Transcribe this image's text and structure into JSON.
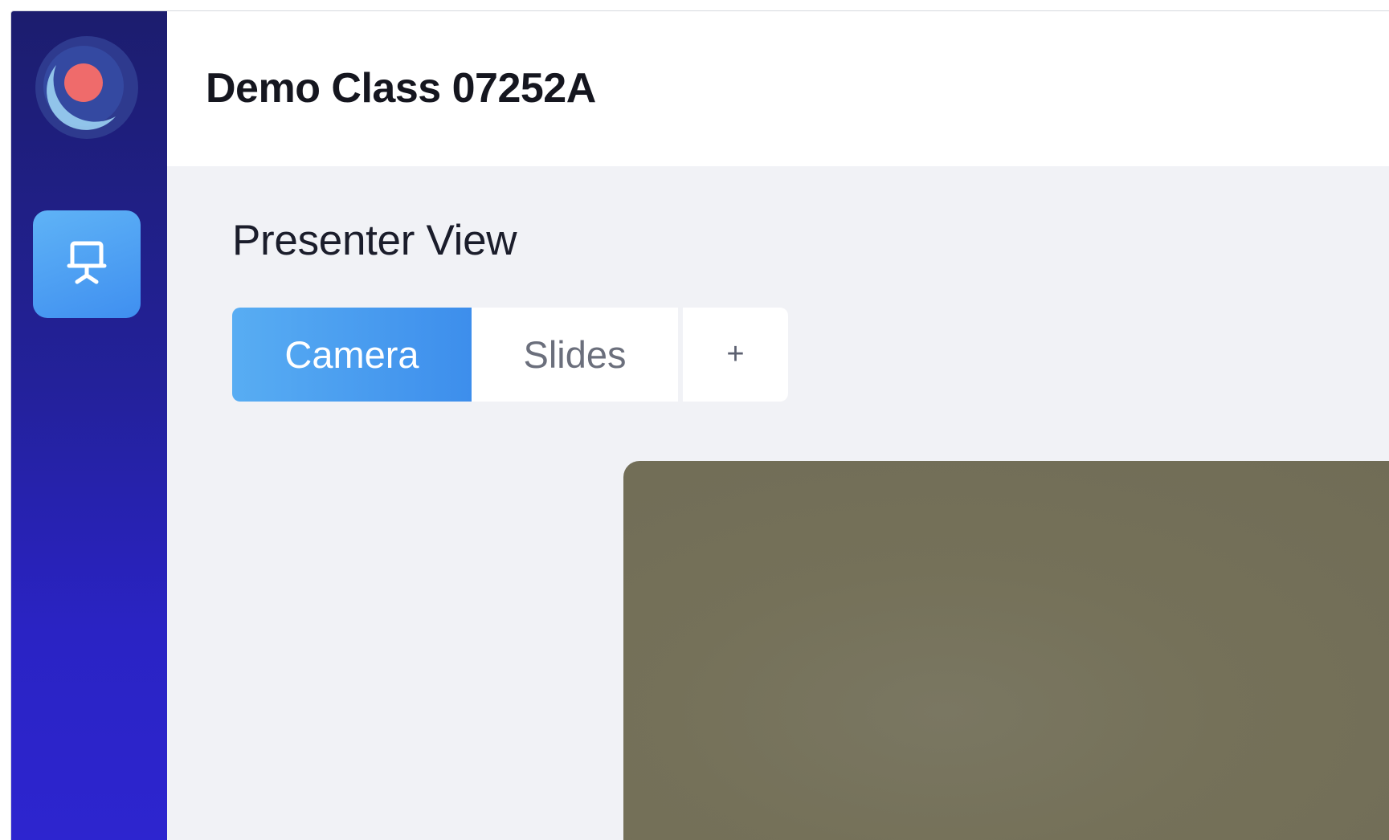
{
  "app": {
    "class_title": "Demo Class 07252A"
  },
  "sidebar": {
    "logo_icon": "app-logo-icon",
    "items": [
      {
        "icon": "presenter-icon",
        "active": true
      }
    ]
  },
  "main": {
    "section_title": "Presenter View",
    "tabs": [
      {
        "label": "Camera",
        "active": true
      },
      {
        "label": "Slides",
        "active": false
      },
      {
        "label": "+",
        "active": false
      }
    ]
  },
  "colors": {
    "sidebar_top": "#1c1d6e",
    "sidebar_bottom": "#2d25cf",
    "accent_blue": "#3d8eec",
    "logo_red": "#ef6b6b",
    "camera_feed": "#757159"
  }
}
